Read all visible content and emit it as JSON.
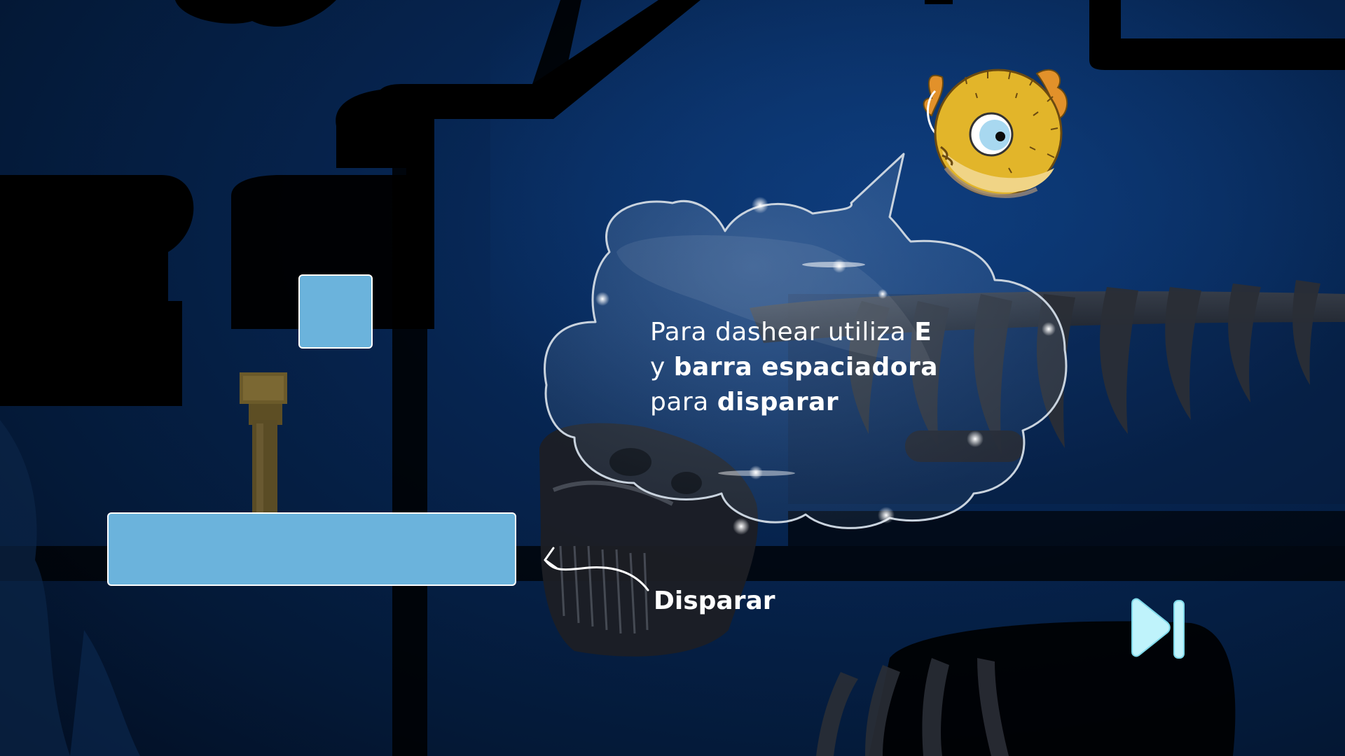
{
  "tutorial": {
    "line1_a": "Para dashear utiliza ",
    "line1_key": "E",
    "line2_a": "y ",
    "line2_key": "barra espaciadora",
    "line3_a": "para ",
    "line3_key": "disparar"
  },
  "callout": {
    "label": "Disparar"
  },
  "icons": {
    "skip": "skip-forward-icon",
    "character": "pufferfish-icon"
  },
  "colors": {
    "placeholder_block": "#6bb3dc",
    "skip_icon": "#bff3fb",
    "fish_body": "#e2b52a"
  }
}
